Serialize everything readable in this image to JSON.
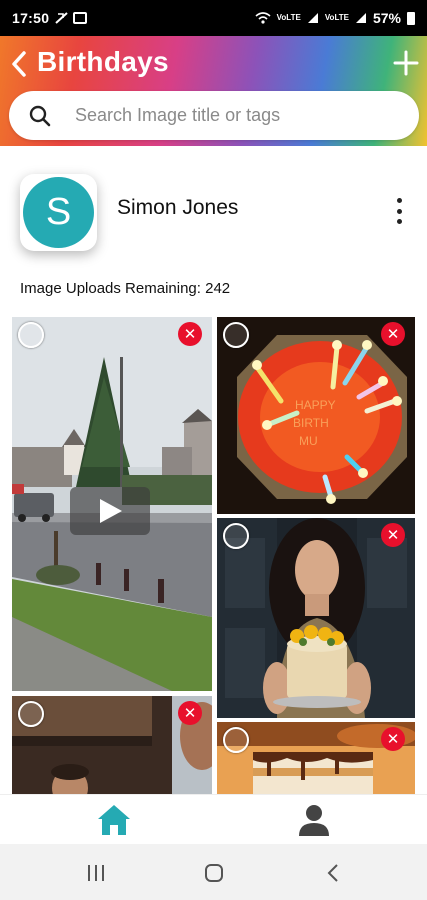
{
  "status_bar": {
    "time": "17:50",
    "battery": "57%",
    "network_1": "VoLTE",
    "network_2": "VoLTE"
  },
  "header": {
    "title": "Birthdays",
    "back_icon": "chevron-left-icon",
    "add_icon": "plus-icon",
    "colors": [
      "#f0782a",
      "#e8453f",
      "#d83f86",
      "#8d52b8",
      "#4a7bd5",
      "#3fb37a",
      "#f2c230"
    ]
  },
  "search": {
    "placeholder": "Search Image title or tags",
    "value": ""
  },
  "profile": {
    "initial": "S",
    "name": "Simon Jones",
    "avatar_color": "#25aab3"
  },
  "uploads_remaining": "Image Uploads Remaining: 242",
  "gallery": {
    "items": [
      {
        "id": "tree-video",
        "kind": "video",
        "delete_label": "✕"
      },
      {
        "id": "birthday-cake-candles",
        "kind": "image",
        "delete_label": "✕"
      },
      {
        "id": "woman-with-cake",
        "kind": "image",
        "delete_label": "✕"
      },
      {
        "id": "man-portrait",
        "kind": "image",
        "delete_label": "✕"
      },
      {
        "id": "man-portrait-2",
        "kind": "image",
        "delete_label": ""
      },
      {
        "id": "dessert-slice",
        "kind": "image",
        "delete_label": "✕"
      }
    ]
  },
  "bottom_nav": {
    "home_icon": "home-icon",
    "profile_icon": "person-icon",
    "active_color": "#25aab3"
  },
  "system_nav": {
    "recent": "recent-apps-icon",
    "home": "home-circle-icon",
    "back": "back-chevron-icon"
  }
}
